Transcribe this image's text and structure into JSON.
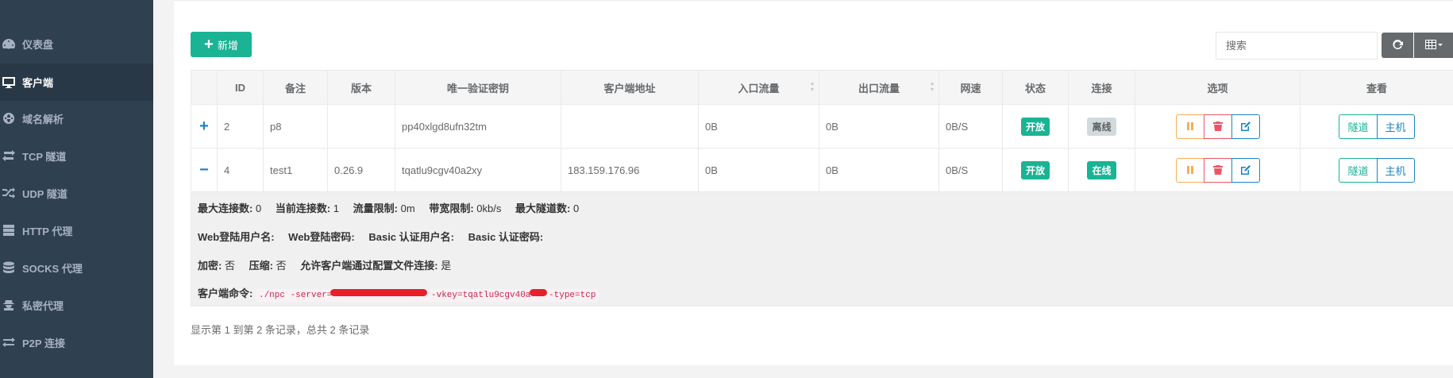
{
  "sidebar": {
    "items": [
      {
        "label": "仪表盘",
        "icon": "dashboard-icon"
      },
      {
        "label": "客户端",
        "icon": "desktop-icon",
        "active": true
      },
      {
        "label": "域名解析",
        "icon": "globe-icon"
      },
      {
        "label": "TCP 隧道",
        "icon": "exchange-icon"
      },
      {
        "label": "UDP 隧道",
        "icon": "random-icon"
      },
      {
        "label": "HTTP 代理",
        "icon": "server-icon"
      },
      {
        "label": "SOCKS 代理",
        "icon": "database-icon"
      },
      {
        "label": "私密代理",
        "icon": "user-secret-icon"
      },
      {
        "label": "P2P 连接",
        "icon": "arrows-icon"
      }
    ]
  },
  "toolbar": {
    "add_label": "新增",
    "search_placeholder": "搜索",
    "refresh_icon": "refresh-icon",
    "columns_icon": "columns-icon"
  },
  "table": {
    "headers": [
      "ID",
      "备注",
      "版本",
      "唯一验证密钥",
      "客户端地址",
      "入口流量",
      "出口流量",
      "网速",
      "状态",
      "连接",
      "选项",
      "查看"
    ],
    "rows": [
      {
        "expander": "+",
        "id": "2",
        "remark": "p8",
        "version": "",
        "vkey": "pp40xlgd8ufn32tm",
        "addr": "",
        "in_flow": "0B",
        "out_flow": "0B",
        "rate": "0B/S",
        "status": "开放",
        "conn": "离线"
      },
      {
        "expander": "−",
        "id": "4",
        "remark": "test1",
        "version": "0.26.9",
        "vkey": "tqatlu9cgv40a2xy",
        "addr": "183.159.176.96",
        "in_flow": "0B",
        "out_flow": "0B",
        "rate": "0B/S",
        "status": "开放",
        "conn": "在线"
      }
    ],
    "view_buttons": [
      "隧道",
      "主机"
    ]
  },
  "detail": {
    "max_conn_label": "最大连接数:",
    "max_conn": "0",
    "cur_conn_label": "当前连接数:",
    "cur_conn": "1",
    "flow_limit_label": "流量限制:",
    "flow_limit": "0m",
    "rate_limit_label": "带宽限制:",
    "rate_limit": "0kb/s",
    "max_tunnel_label": "最大隧道数:",
    "max_tunnel": "0",
    "web_user_label": "Web登陆用户名:",
    "web_pass_label": "Web登陆密码:",
    "basic_user_label": "Basic 认证用户名:",
    "basic_pass_label": "Basic 认证密码:",
    "crypt_label": "加密:",
    "crypt": "否",
    "compress_label": "压缩:",
    "compress": "否",
    "config_conn_label": "允许客户端通过配置文件连接:",
    "config_conn": "是",
    "cmd_label": "客户端命令:",
    "cmd_part1": "./npc -server=",
    "cmd_part2": " -vkey=tqatlu9cgv40a",
    "cmd_part3": " -type=tcp"
  },
  "footer": {
    "summary": "显示第 1 到第 2 条记录，总共 2 条记录"
  }
}
